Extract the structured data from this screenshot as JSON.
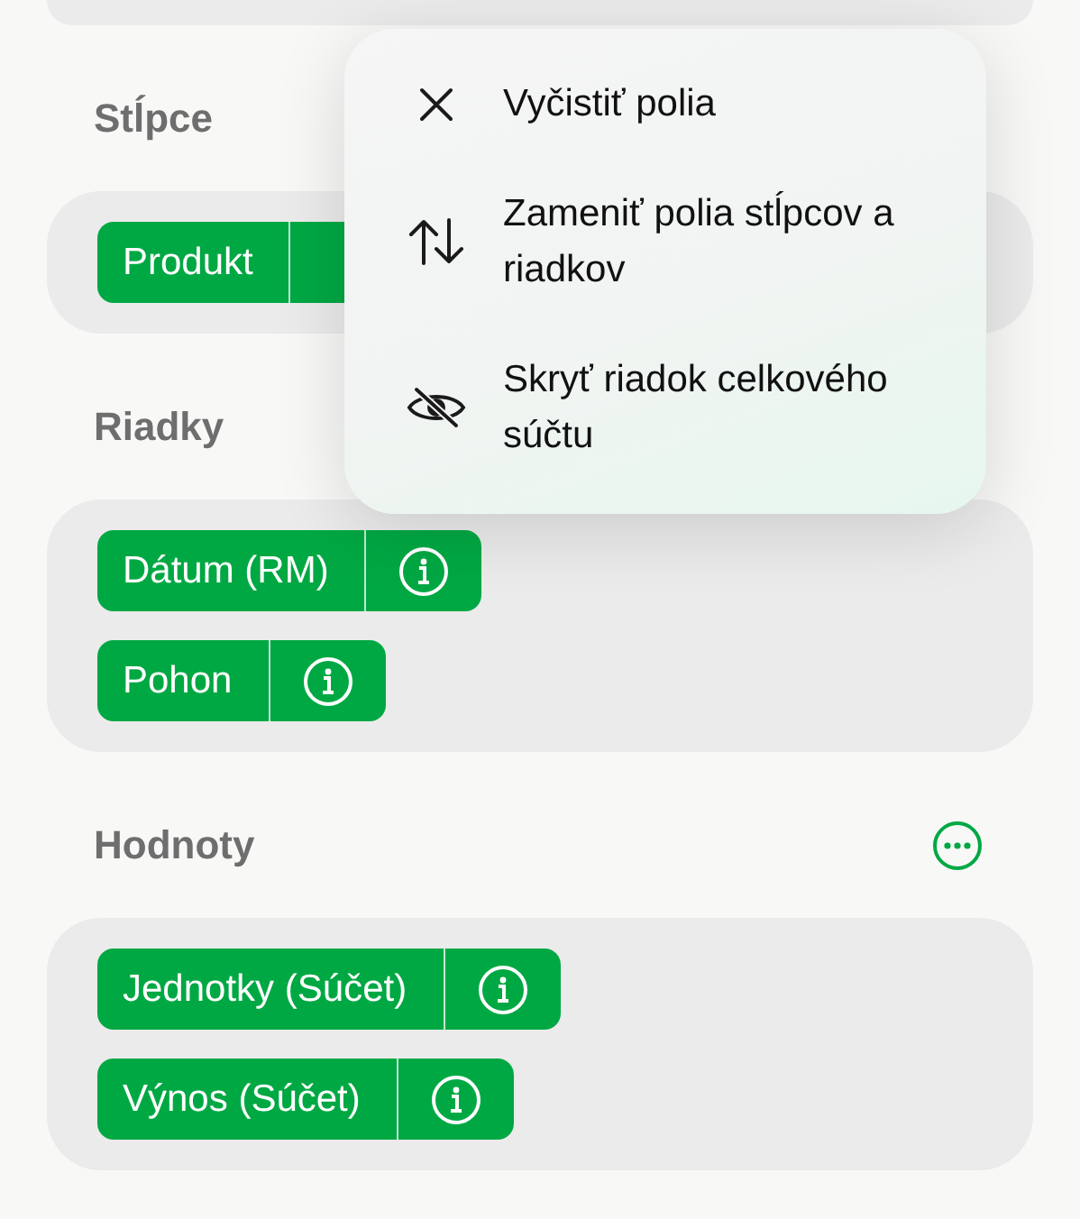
{
  "sections": [
    {
      "title": "Stĺpce",
      "fields": [
        {
          "label": "Produkt",
          "info_visible": false
        }
      ]
    },
    {
      "title": "Riadky",
      "fields": [
        {
          "label": "Dátum (RM)",
          "info_visible": true
        },
        {
          "label": "Pohon",
          "info_visible": true
        }
      ]
    },
    {
      "title": "Hodnoty",
      "more_button": true,
      "fields": [
        {
          "label": "Jednotky (Súčet)",
          "info_visible": true
        },
        {
          "label": "Výnos (Súčet)",
          "info_visible": true
        }
      ]
    }
  ],
  "menu": {
    "items": [
      {
        "kind": "clear",
        "label": "Vyčistiť polia"
      },
      {
        "kind": "swap",
        "label": "Zameniť polia stĺpcov a riadkov"
      },
      {
        "kind": "hide",
        "label": "Skryť riadok celkového súčtu"
      }
    ]
  }
}
